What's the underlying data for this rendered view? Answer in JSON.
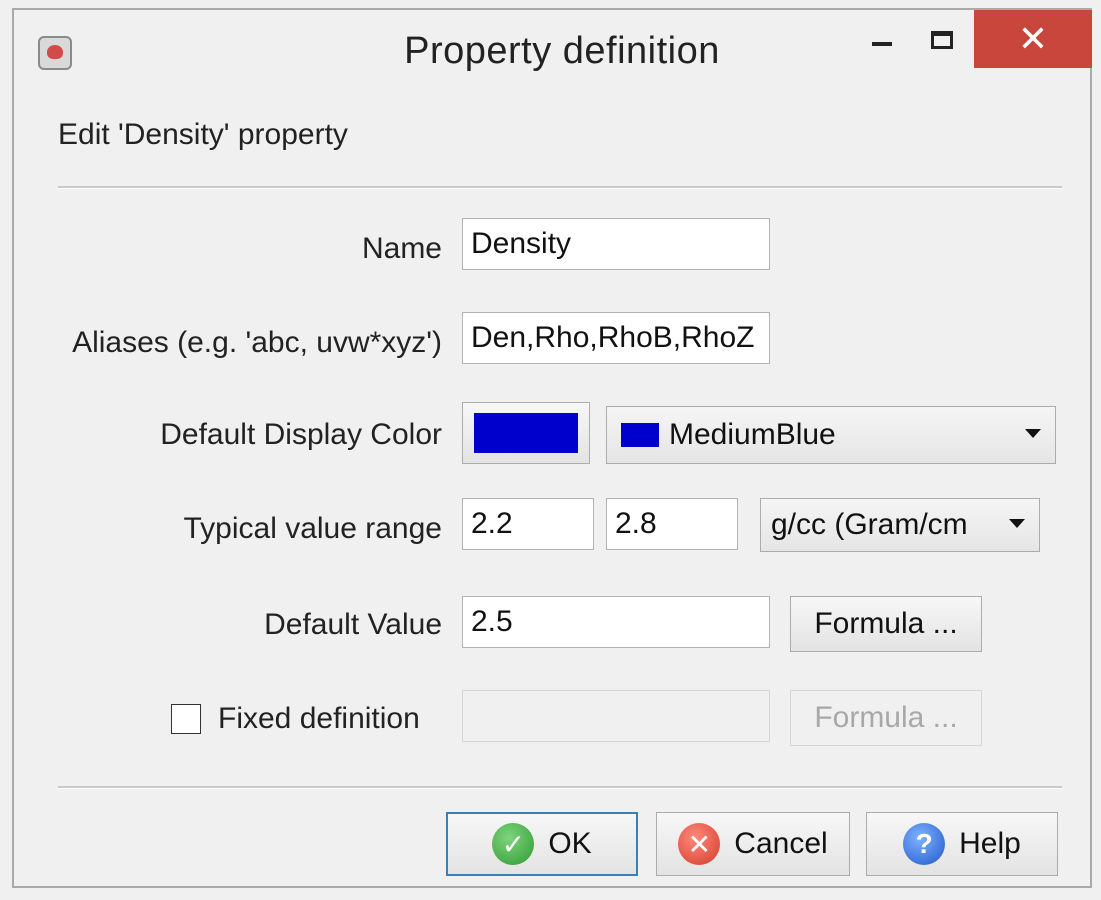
{
  "window": {
    "title": "Property definition",
    "close_glyph": "✕"
  },
  "header": {
    "edit_label": "Edit 'Density' property"
  },
  "form": {
    "name_label": "Name",
    "name_value": "Density",
    "aliases_label": "Aliases (e.g. 'abc, uvw*xyz')",
    "aliases_value": "Den,Rho,RhoB,RhoZ",
    "color_label": "Default Display Color",
    "color_value": "#0000cd",
    "color_name": "MediumBlue",
    "range_label": "Typical value range",
    "range_min": "2.2",
    "range_max": "2.8",
    "unit": "g/cc (Gram/cm",
    "default_label": "Default Value",
    "default_value": "2.5",
    "formula_label": "Formula ...",
    "fixed_label": "Fixed definition",
    "fixed_checked": false,
    "fixed_formula_label": "Formula ..."
  },
  "buttons": {
    "ok": "OK",
    "cancel": "Cancel",
    "help": "Help"
  },
  "icons": {
    "app": "app-icon",
    "ok": "check-icon",
    "cancel": "cancel-icon",
    "help": "help-icon",
    "dropdown": "chevron-down-icon"
  }
}
